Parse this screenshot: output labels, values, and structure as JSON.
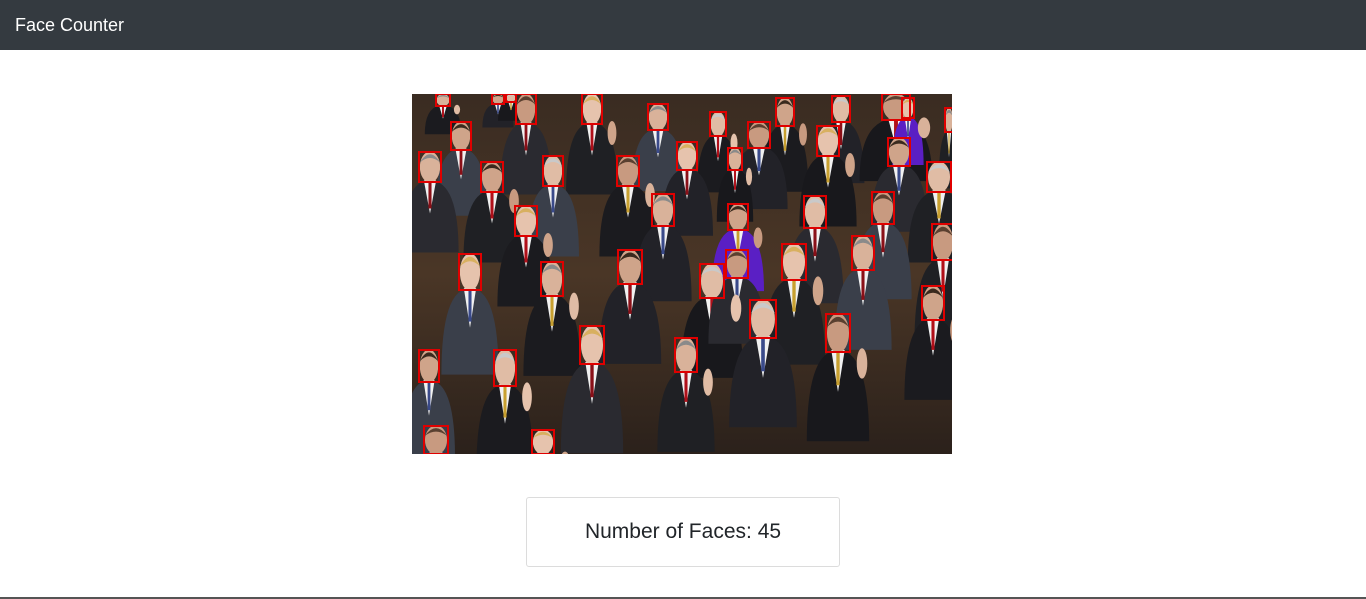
{
  "navbar": {
    "brand": "Face Counter"
  },
  "result": {
    "label": "Number of Faces:",
    "count": "45"
  },
  "image": {
    "subject": "crowd photo with detected faces outlined",
    "box_color": "#e00000"
  }
}
